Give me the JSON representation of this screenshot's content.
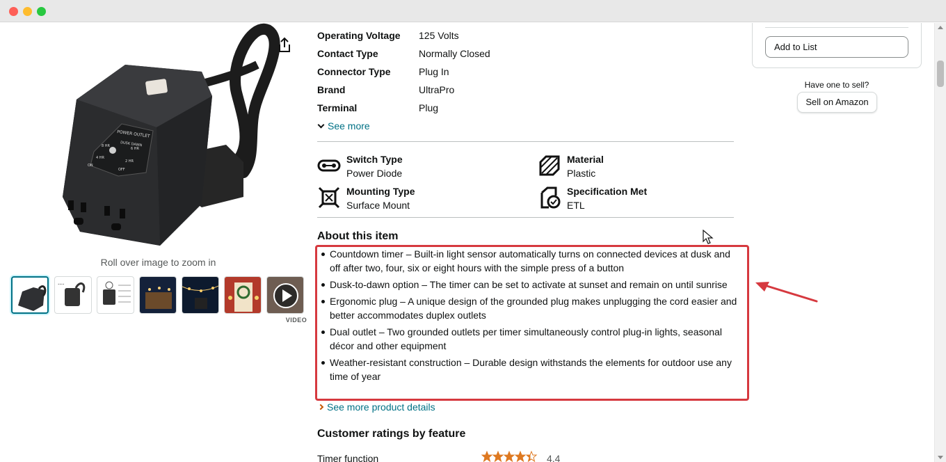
{
  "window": {
    "controls": [
      "close",
      "minimize",
      "maximize"
    ]
  },
  "gallery": {
    "zoom_hint": "Roll over image to zoom in",
    "video_label": "VIDEO",
    "main_image_text": {
      "title": "POWER OUTLET",
      "mode": "DUSK DAWN",
      "h8": "8 HR",
      "h6": "6 HR",
      "h4": "4 HR",
      "h2": "2 HR",
      "on": "ON",
      "off": "OFF"
    }
  },
  "specs": {
    "rows": [
      {
        "key": "Operating Voltage",
        "value": "125 Volts"
      },
      {
        "key": "Contact Type",
        "value": "Normally Closed"
      },
      {
        "key": "Connector Type",
        "value": "Plug In"
      },
      {
        "key": "Brand",
        "value": "UltraPro"
      },
      {
        "key": "Terminal",
        "value": "Plug"
      }
    ],
    "see_more": "See more"
  },
  "features": [
    {
      "title": "Switch Type",
      "value": "Power Diode",
      "icon": "switch-icon"
    },
    {
      "title": "Material",
      "value": "Plastic",
      "icon": "material-icon"
    },
    {
      "title": "Mounting Type",
      "value": "Surface Mount",
      "icon": "mounting-icon"
    },
    {
      "title": "Specification Met",
      "value": "ETL",
      "icon": "specification-icon"
    }
  ],
  "about": {
    "title": "About this item",
    "bullets": [
      "Countdown timer – Built-in light sensor automatically turns on connected devices at dusk and off after two, four, six or eight hours with the simple press of a button",
      "Dusk-to-dawn option – The timer can be set to activate at sunset and remain on until sunrise",
      "Ergonomic plug – A unique design of the grounded plug makes unplugging the cord easier and better accommodates duplex outlets",
      "Dual outlet – Two grounded outlets per timer simultaneously control plug-in lights, seasonal décor and other equipment",
      "Weather-resistant construction – Durable design withstands the elements for outdoor use any time of year"
    ],
    "see_more_details": "See more product details"
  },
  "ratings": {
    "title": "Customer ratings by feature",
    "rows": [
      {
        "label": "Timer function",
        "value": "4.4"
      }
    ]
  },
  "buybox": {
    "add_to_list": "Add to List",
    "have_one": "Have one to sell?",
    "sell_button": "Sell on Amazon"
  },
  "colors": {
    "link": "#007185",
    "highlight": "#d6393f",
    "star": "#de7921"
  }
}
